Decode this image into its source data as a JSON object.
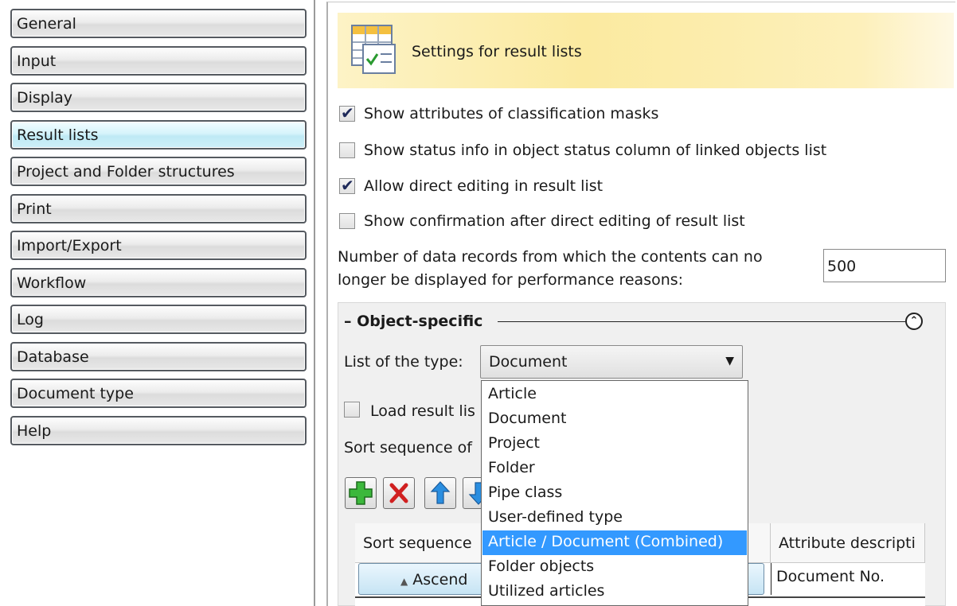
{
  "nav": {
    "items": [
      {
        "label": "General"
      },
      {
        "label": "Input"
      },
      {
        "label": "Display"
      },
      {
        "label": "Result lists"
      },
      {
        "label": "Project and Folder structures"
      },
      {
        "label": "Print"
      },
      {
        "label": "Import/Export"
      },
      {
        "label": "Workflow"
      },
      {
        "label": "Log"
      },
      {
        "label": "Database"
      },
      {
        "label": "Document type"
      },
      {
        "label": "Help"
      }
    ],
    "selected": "Result lists"
  },
  "header": {
    "title": "Settings for result lists",
    "icon": "table-check-icon"
  },
  "options": [
    {
      "label": "Show attributes of classification masks",
      "checked": true
    },
    {
      "label": "Show status info in object status column of linked objects list",
      "checked": false
    },
    {
      "label": "Allow direct editing in result list",
      "checked": true
    },
    {
      "label": "Show confirmation after direct editing of result list",
      "checked": false
    }
  ],
  "performance": {
    "label_line1": "Number of data records from which the contents can no",
    "label_line2": "longer be displayed for performance reasons:",
    "value": "500"
  },
  "object_specific": {
    "title": "Object-specific",
    "collapse_symbol": "⌃",
    "type_label": "List of the type:",
    "type_value": "Document",
    "load_label": "Load result lis",
    "sort_label": "Sort sequence of",
    "toolbar": [
      "add-icon",
      "delete-icon",
      "move-up-icon",
      "move-down-icon"
    ],
    "table": {
      "col1_header": "Sort sequence",
      "col2_header": "Attribute descripti",
      "row1_sort": "Ascend",
      "row1_attr": "Document No."
    }
  },
  "dropdown": {
    "options": [
      "Article",
      "Document",
      "Project",
      "Folder",
      "Pipe class",
      "User-defined type",
      "Article / Document (Combined)",
      "Folder objects",
      "Utilized articles"
    ],
    "highlighted": "Article / Document (Combined)"
  },
  "colors": {
    "highlight": "#3399ff",
    "header_bg": "#fbeaa0",
    "selected_nav": "#bfeaf5"
  }
}
